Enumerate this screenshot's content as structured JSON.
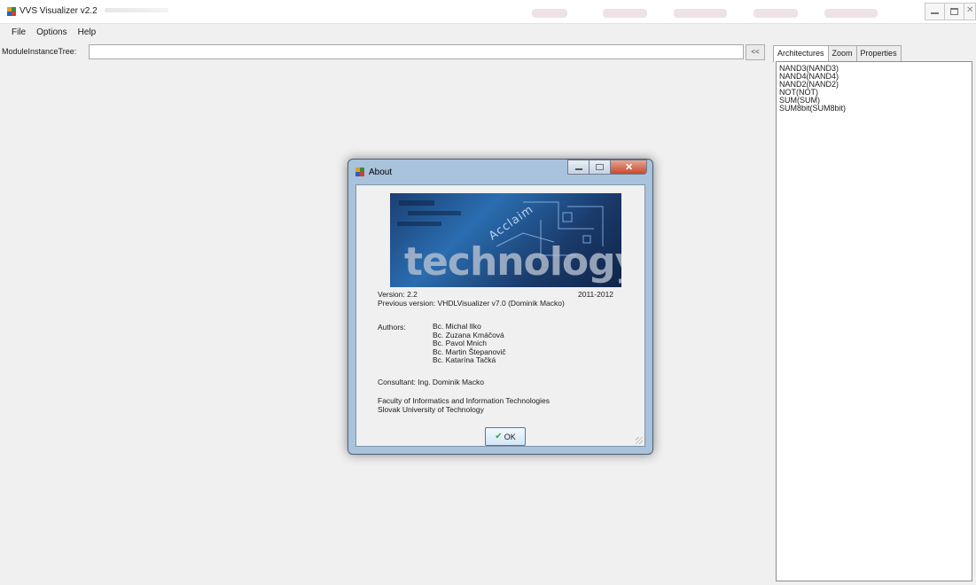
{
  "window": {
    "title": "VVS Visualizer v2.2",
    "controls": {
      "minimize": "minimize-icon",
      "restore": "restore-icon",
      "close": "close-icon"
    }
  },
  "menu": [
    "File",
    "Options",
    "Help"
  ],
  "toolbar": {
    "module_tree_label": "ModuleInstanceTree:",
    "module_tree_value": "",
    "collapse_label": "<<"
  },
  "right_panel": {
    "tabs": [
      "Architectures",
      "Zoom",
      "Properties"
    ],
    "active_tab": "Architectures",
    "architectures": [
      "NAND3(NAND3)",
      "NAND4(NAND4)",
      "NAND2(NAND2)",
      "NOT(NOT)",
      "SUM(SUM)",
      "SUM8bit(SUM8bit)"
    ]
  },
  "about": {
    "title": "About",
    "banner": {
      "tag": "Acclaim",
      "word": "technology"
    },
    "version_label": "Version: 2.2",
    "years": "2011-2012",
    "previous_version": "Previous version: VHDLVisualizer v7.0 (Dominik Macko)",
    "authors_label": "Authors:",
    "authors": [
      "Bc. Michal Ilko",
      "Bc. Zuzana Kmáčová",
      "Bc. Pavol Mnich",
      "Bc. Martin Štepanovič",
      "Bc. Katarína Tačká"
    ],
    "consultant": "Consultant: Ing. Dominik Macko",
    "faculty_line1": "Faculty of Informatics and Information Technologies",
    "faculty_line2": "Slovak University of Technology",
    "ok_label": "OK"
  },
  "colors": {
    "dialog_frame": "#a9c3dd",
    "window_bg": "#f0f0f0",
    "close_red": "#c9482f"
  }
}
